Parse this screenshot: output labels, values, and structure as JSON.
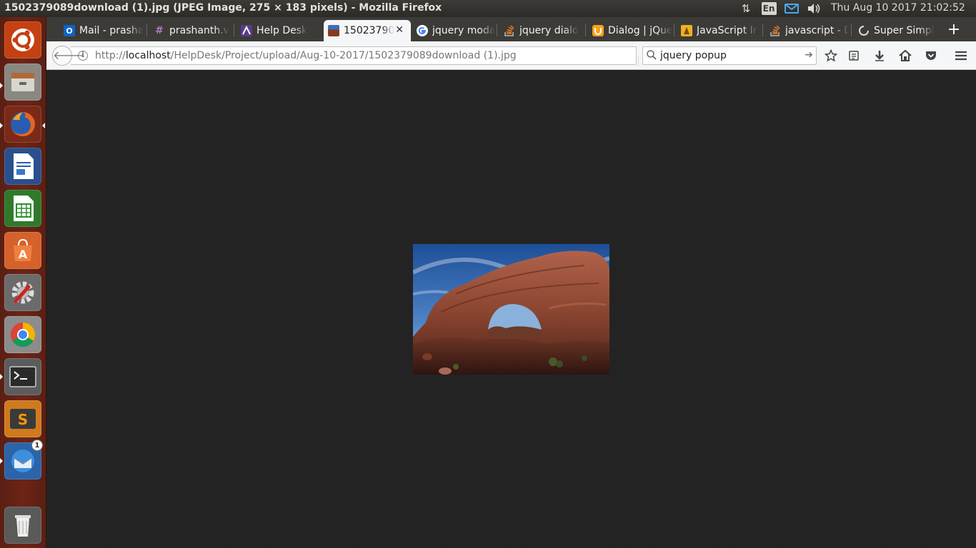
{
  "window": {
    "title": "1502379089download (1).jpg (JPEG Image, 275 × 183 pixels) - Mozilla Firefox"
  },
  "panel": {
    "lang": "En",
    "clock": "Thu Aug 10 2017 21:02:52"
  },
  "launcher": {
    "thunderbird_badge": "1"
  },
  "tabs": [
    {
      "label": "Mail - prasha",
      "icon": "outlook-icon"
    },
    {
      "label": "prashanth.v",
      "icon": "hash-icon"
    },
    {
      "label": "Help Desk",
      "icon": "helpdesk-icon"
    },
    {
      "label": "15023790",
      "icon": "image-thumbnail-icon",
      "active": true
    },
    {
      "label": "jquery moda",
      "icon": "google-icon"
    },
    {
      "label": "jquery dialo",
      "icon": "stackoverflow-icon"
    },
    {
      "label": "Dialog | jQue",
      "icon": "jqueryui-icon"
    },
    {
      "label": "JavaScript Ir",
      "icon": "js-icon"
    },
    {
      "label": "javascript - D",
      "icon": "stackoverflow-icon"
    },
    {
      "label": "Super Simpl",
      "icon": "spinner-icon"
    }
  ],
  "toolbar": {
    "url_scheme": "http://",
    "url_host": "localhost",
    "url_path": "/HelpDesk/Project/upload/Aug-10-2017/1502379089download (1).jpg",
    "search_value": "jquery popup"
  },
  "colors": {
    "launcher": "#6d2416",
    "panel": "#3c3b37",
    "content": "#222222",
    "chrome": "#f5f6f7"
  }
}
